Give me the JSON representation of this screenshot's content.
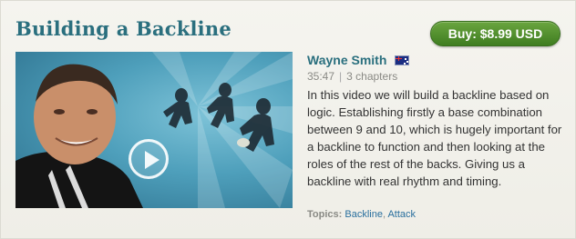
{
  "video": {
    "title": "Building a Backline",
    "buy_label": "Buy: $8.99 USD",
    "author": "Wayne Smith",
    "author_flag": "flag-icon-new-zealand",
    "duration": "35:47",
    "separator": "|",
    "chapters": "3 chapters",
    "description": "In this video we will build a backline based on logic. Establishing firstly a base combination between 9 and 10, which is hugely important for a backline to function and then looking at the roles of the rest of the backs. Giving us a backline with real rhythm and timing.",
    "topics_label": "Topics:",
    "topics": [
      {
        "label": "Backline"
      },
      {
        "label": "Attack"
      }
    ]
  },
  "colors": {
    "title": "#2a6f7e",
    "buy_button": "#4f8f2c",
    "link": "#2a6f9e",
    "background": "#f1f0ea"
  }
}
